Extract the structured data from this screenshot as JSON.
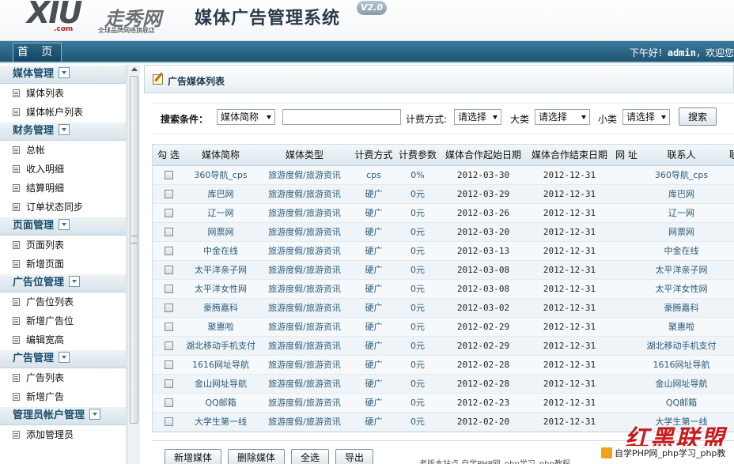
{
  "header": {
    "logo_main": "XIU",
    "logo_cn": "走秀网",
    "logo_sub_com": ".com",
    "logo_sub": "全球品牌网络旗舰店",
    "system_title": "媒体广告管理系统",
    "version": "V2.0"
  },
  "nav": {
    "home": "首 页",
    "greeting_prefix": "下午好！",
    "user": "admin",
    "greeting_suffix": "，欢迎您"
  },
  "sidebar": {
    "groups": [
      {
        "title": "媒体管理",
        "items": [
          "媒体列表",
          "媒体帐户列表"
        ]
      },
      {
        "title": "财务管理",
        "items": [
          "总帐",
          "收入明细",
          "结算明细",
          "订单状态同步"
        ]
      },
      {
        "title": "页面管理",
        "items": [
          "页面列表",
          "新增页面"
        ]
      },
      {
        "title": "广告位管理",
        "items": [
          "广告位列表",
          "新增广告位",
          "编辑宽高"
        ]
      },
      {
        "title": "广告管理",
        "items": [
          "广告列表",
          "新增广告"
        ]
      },
      {
        "title": "管理员帐户管理",
        "items": [
          "添加管理员"
        ]
      }
    ]
  },
  "panel": {
    "title": "广告媒体列表"
  },
  "search": {
    "label": "搜索条件：",
    "field_select": "媒体简称",
    "keyword_value": "",
    "billing_label": "计费方式:",
    "billing_select": "请选择",
    "major_label": "大类",
    "major_select": "请选择",
    "minor_label": "小类",
    "minor_select": "请选择",
    "search_button": "搜索"
  },
  "table": {
    "headers": [
      "勾 选",
      "媒体简称",
      "媒体类型",
      "计费方式",
      "计费参数",
      "媒体合作起始日期",
      "媒体合作结束日期",
      "网 址",
      "联系人",
      "联"
    ],
    "rows": [
      {
        "name": "360导航_cps",
        "type": "旅游度假/旅游资讯",
        "billing": "cps",
        "param": "0%",
        "start": "2012-03-30",
        "end": "2012-12-31",
        "url": "",
        "contact": "360导航_cps"
      },
      {
        "name": "库巴网",
        "type": "旅游度假/旅游资讯",
        "billing": "硬广",
        "param": "0元",
        "start": "2012-03-29",
        "end": "2012-12-31",
        "url": "",
        "contact": "库巴网"
      },
      {
        "name": "辽一网",
        "type": "旅游度假/旅游资讯",
        "billing": "硬广",
        "param": "0元",
        "start": "2012-03-26",
        "end": "2012-12-31",
        "url": "",
        "contact": "辽一网"
      },
      {
        "name": "网票网",
        "type": "旅游度假/旅游资讯",
        "billing": "硬广",
        "param": "0元",
        "start": "2012-03-20",
        "end": "2012-12-31",
        "url": "",
        "contact": "网票网"
      },
      {
        "name": "中金在线",
        "type": "旅游度假/旅游资讯",
        "billing": "硬广",
        "param": "0元",
        "start": "2012-03-13",
        "end": "2012-12-31",
        "url": "",
        "contact": "中金在线"
      },
      {
        "name": "太平洋亲子网",
        "type": "旅游度假/旅游资讯",
        "billing": "硬广",
        "param": "0元",
        "start": "2012-03-08",
        "end": "2012-12-31",
        "url": "",
        "contact": "太平洋亲子网"
      },
      {
        "name": "太平洋女性网",
        "type": "旅游度假/旅游资讯",
        "billing": "硬广",
        "param": "0元",
        "start": "2012-03-08",
        "end": "2012-12-31",
        "url": "",
        "contact": "太平洋女性网"
      },
      {
        "name": "豪腾嘉科",
        "type": "旅游度假/旅游资讯",
        "billing": "硬广",
        "param": "0元",
        "start": "2012-03-02",
        "end": "2012-12-31",
        "url": "",
        "contact": "豪腾嘉科"
      },
      {
        "name": "聚惠啦",
        "type": "旅游度假/旅游资讯",
        "billing": "硬广",
        "param": "0元",
        "start": "2012-02-29",
        "end": "2012-12-31",
        "url": "",
        "contact": "聚惠啦"
      },
      {
        "name": "湖北移动手机支付",
        "type": "旅游度假/旅游资讯",
        "billing": "硬广",
        "param": "0元",
        "start": "2012-02-29",
        "end": "2012-12-31",
        "url": "",
        "contact": "湖北移动手机支付"
      },
      {
        "name": "1616网址导航",
        "type": "旅游度假/旅游资讯",
        "billing": "硬广",
        "param": "0元",
        "start": "2012-02-28",
        "end": "2012-12-31",
        "url": "",
        "contact": "1616网址导航"
      },
      {
        "name": "金山网址导航",
        "type": "旅游度假/旅游资讯",
        "billing": "硬广",
        "param": "0元",
        "start": "2012-02-28",
        "end": "2012-12-31",
        "url": "",
        "contact": "金山网址导航"
      },
      {
        "name": "QQ邮箱",
        "type": "旅游度假/旅游资讯",
        "billing": "硬广",
        "param": "0元",
        "start": "2012-02-23",
        "end": "2012-12-31",
        "url": "",
        "contact": "QQ邮箱"
      },
      {
        "name": "大学生第一线",
        "type": "旅游度假/旅游资讯",
        "billing": "硬广",
        "param": "0元",
        "start": "2012-02-20",
        "end": "2012-12-31",
        "url": "",
        "contact": "大学生第一线"
      }
    ]
  },
  "actions": [
    "新增媒体",
    "删除媒体",
    "全选",
    "导出"
  ],
  "watermark": {
    "brand": "红黑联盟",
    "site": "自学PHP网_php学习_php教",
    "faint": "老版本站点 自学PHP网_php学习_php教程"
  }
}
